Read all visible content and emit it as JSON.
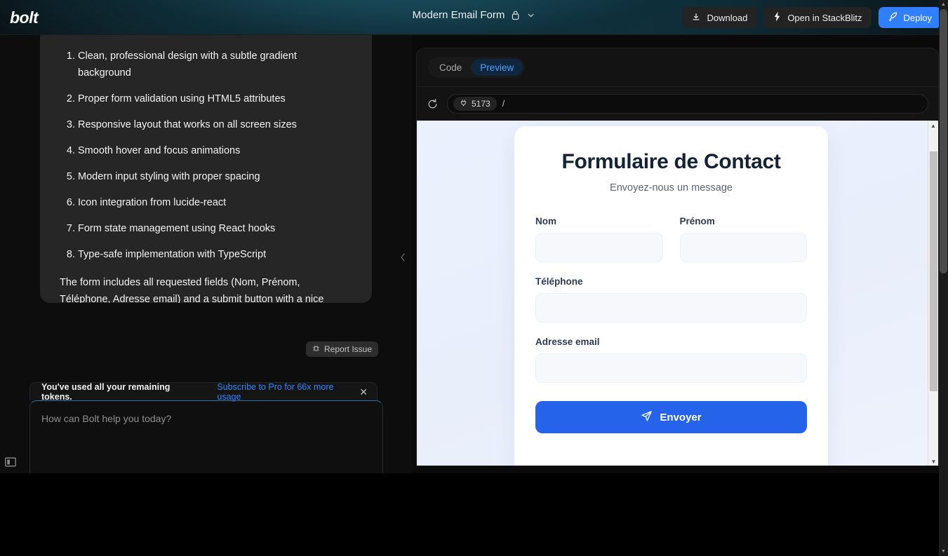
{
  "header": {
    "logo": "bolt",
    "project_title": "Modern Email Form",
    "lock_icon": "lock-icon",
    "chevron_icon": "chevron-down-icon",
    "actions": [
      {
        "id": "download",
        "label": "Download",
        "icon": "download-icon",
        "primary": false
      },
      {
        "id": "stackblitz",
        "label": "Open in StackBlitz",
        "icon": "lightning-bolt-icon",
        "primary": false
      },
      {
        "id": "deploy",
        "label": "Deploy",
        "icon": "rocket-icon",
        "primary": true
      }
    ],
    "accent_color": "#2f7ffe"
  },
  "chat": {
    "message": {
      "list": [
        "Clean, professional design with a subtle gradient background",
        "Proper form validation using HTML5 attributes",
        "Responsive layout that works on all screen sizes",
        "Smooth hover and focus animations",
        "Modern input styling with proper spacing",
        "Icon integration from lucide-react",
        "Form state management using React hooks",
        "Type-safe implementation with TypeScript"
      ],
      "numbers": [
        "1.",
        "2.",
        "3.",
        "4.",
        "5.",
        "6.",
        "7.",
        "8."
      ],
      "paragraph": "The form includes all requested fields (Nom, Prénom, Téléphone, Adresse email) and a submit button with a nice hover effect and icon."
    },
    "report_issue": {
      "label": "Report Issue",
      "icon": "bug-icon"
    },
    "token_banner": {
      "message": "You've used all your remaining tokens.",
      "link": "Subscribe to Pro for 66x more usage",
      "close": "✕",
      "link_color": "#2f86ff"
    },
    "composer": {
      "placeholder": "How can Bolt help you today?",
      "attach_icon": "paperclip-icon",
      "enhance_icon": "sparkles-icon"
    },
    "collapse_icon": "chevron-left-icon",
    "sidebar_toggle_icon": "sidebar-toggle-icon"
  },
  "preview": {
    "tabs": [
      {
        "id": "code",
        "label": "Code",
        "active": false
      },
      {
        "id": "preview",
        "label": "Preview",
        "active": true
      }
    ],
    "reload_icon": "reload-icon",
    "port_badge": {
      "icon": "plug-icon",
      "value": "5173"
    },
    "path": "/",
    "background_color": "#eaf1fd"
  },
  "form": {
    "title": "Formulaire de Contact",
    "subtitle": "Envoyez-nous un message",
    "fields": [
      {
        "id": "nom",
        "label": "Nom",
        "value": ""
      },
      {
        "id": "prenom",
        "label": "Prénom",
        "value": ""
      },
      {
        "id": "telephone",
        "label": "Téléphone",
        "value": ""
      },
      {
        "id": "email",
        "label": "Adresse email",
        "value": ""
      }
    ],
    "submit": {
      "label": "Envoyer",
      "icon": "send-icon",
      "color": "#2563eb"
    }
  }
}
